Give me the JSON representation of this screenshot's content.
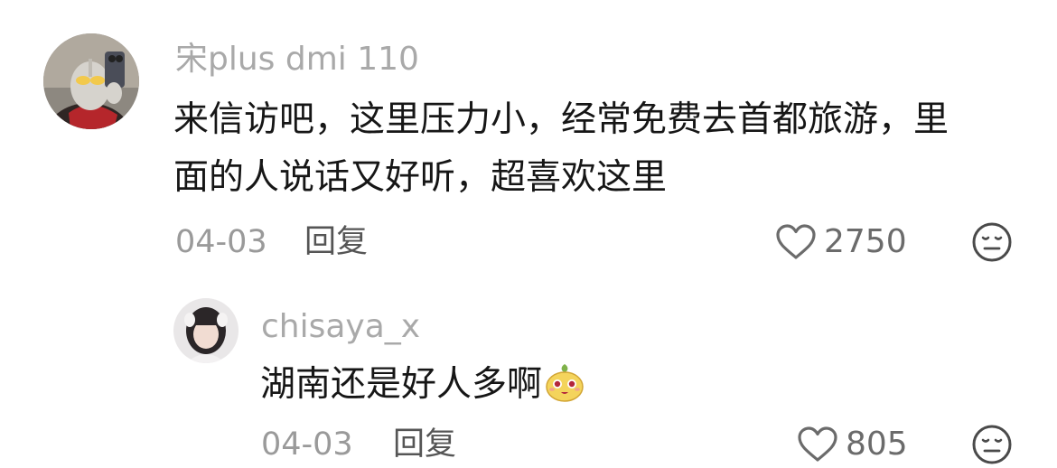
{
  "comments": [
    {
      "username": "宋plus dmi 110",
      "lines": [
        "来信访吧，这里压力小，经常免费去首都旅游，里",
        "面的人说话又好听，超喜欢这里"
      ],
      "date": "04-03",
      "reply_label": "回复",
      "likes": "2750"
    }
  ],
  "replies": [
    {
      "username": "chisaya_x",
      "text": "湖南还是好人多啊",
      "emoji": "smiling-bun-emoji",
      "date": "04-03",
      "reply_label": "回复",
      "likes": "805"
    }
  ],
  "colors": {
    "username": "#a9a9a9",
    "text": "#161616",
    "meta": "#9a9a9a",
    "icon": "#6b6b6b"
  }
}
